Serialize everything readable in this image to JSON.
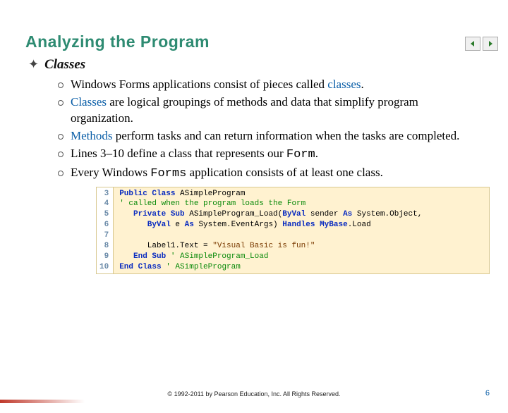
{
  "title": "Analyzing the Program",
  "section_label": "Classes",
  "bullets": [
    {
      "pre": "Windows Forms applications consist of pieces called ",
      "term": "classes",
      "post": "."
    },
    {
      "pre": "",
      "term": "Classes",
      "post": " are logical groupings of methods and data that simplify program organization."
    },
    {
      "pre": "",
      "term": "Methods",
      "post": " perform tasks and can return information when the tasks are completed."
    },
    {
      "pre": "Lines 3–10 define a class that represents our ",
      "term": "",
      "mono": "Form",
      "post": "."
    },
    {
      "pre": "Every Windows ",
      "term": "",
      "mono": "Forms",
      "post": " application consists of at least one class."
    }
  ],
  "code": {
    "line_numbers": [
      "3",
      "4",
      "5",
      "6",
      "7",
      "8",
      "9",
      "10"
    ],
    "l3a": "Public Class",
    "l3b": " ASimpleProgram",
    "l4": "' called when the program loads the Form",
    "l5a": "   Private Sub",
    "l5b": " ASimpleProgram_Load(",
    "l5c": "ByVal",
    "l5d": " sender ",
    "l5e": "As",
    "l5f": " System.Object,",
    "l6a": "      ByVal",
    "l6b": " e ",
    "l6c": "As",
    "l6d": " System.EventArgs) ",
    "l6e": "Handles MyBase",
    "l6f": ".Load",
    "l8a": "      Label1.Text = ",
    "l8b": "\"Visual Basic is fun!\"",
    "l9a": "   End Sub",
    "l9b": " ' ASimpleProgram_Load",
    "l10a": "End Class",
    "l10b": " ' ASimpleProgram"
  },
  "footer": "© 1992-2011 by Pearson Education, Inc. All Rights Reserved.",
  "page_number": "6"
}
